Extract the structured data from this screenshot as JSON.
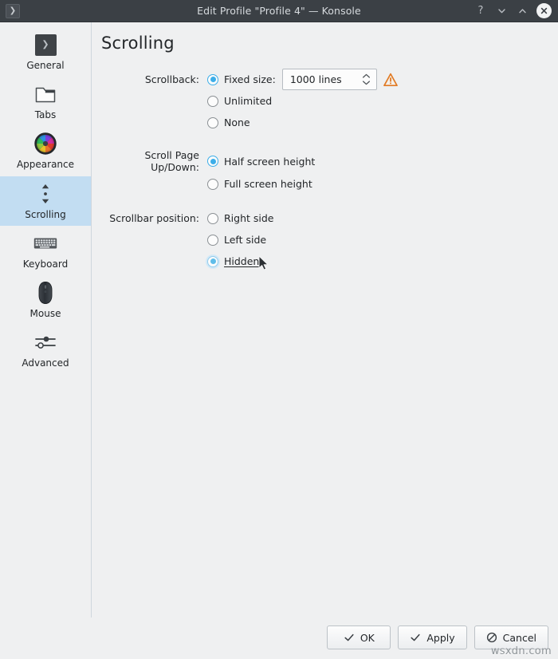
{
  "window": {
    "title": "Edit Profile \"Profile 4\" — Konsole",
    "app_icon": "terminal-icon",
    "controls": {
      "help": "?",
      "minimize": "minimize-icon",
      "maximize": "maximize-icon",
      "close": "close-icon"
    }
  },
  "sidebar": {
    "items": [
      {
        "label": "General",
        "icon": "terminal-icon",
        "selected": false
      },
      {
        "label": "Tabs",
        "icon": "folder-icon",
        "selected": false
      },
      {
        "label": "Appearance",
        "icon": "color-wheel-icon",
        "selected": false
      },
      {
        "label": "Scrolling",
        "icon": "scroll-icon",
        "selected": true
      },
      {
        "label": "Keyboard",
        "icon": "keyboard-icon",
        "selected": false
      },
      {
        "label": "Mouse",
        "icon": "mouse-icon",
        "selected": false
      },
      {
        "label": "Advanced",
        "icon": "sliders-icon",
        "selected": false
      }
    ]
  },
  "main": {
    "page_title": "Scrolling",
    "groups": [
      {
        "label": "Scrollback:",
        "name": "scrollback",
        "options": [
          {
            "label": "Fixed size:",
            "checked": true,
            "focused": false
          },
          {
            "label": "Unlimited",
            "checked": false,
            "focused": false
          },
          {
            "label": "None",
            "checked": false,
            "focused": false
          }
        ],
        "spinbox": {
          "value": "1000 lines"
        },
        "warning": "warning-icon"
      },
      {
        "label": "Scroll Page Up/Down:",
        "name": "scroll-page",
        "options": [
          {
            "label": "Half screen height",
            "checked": true,
            "focused": false
          },
          {
            "label": "Full screen height",
            "checked": false,
            "focused": false
          }
        ]
      },
      {
        "label": "Scrollbar position:",
        "name": "scrollbar-position",
        "options": [
          {
            "label": "Right side",
            "checked": false,
            "focused": false
          },
          {
            "label": "Left side",
            "checked": false,
            "focused": false
          },
          {
            "label": "Hidden",
            "checked": true,
            "focused": true
          }
        ]
      }
    ]
  },
  "footer": {
    "buttons": [
      {
        "label": "OK",
        "icon": "check-icon"
      },
      {
        "label": "Apply",
        "icon": "check-icon"
      },
      {
        "label": "Cancel",
        "icon": "cancel-icon"
      }
    ]
  },
  "watermark": {
    "text": "wsxdn.com"
  },
  "colors": {
    "titlebar_bg": "#3b4045",
    "window_bg": "#eff0f1",
    "accent": "#3daee9",
    "selection_bg": "#c2ddf2",
    "warning": "#e8833a",
    "text": "#232629"
  }
}
